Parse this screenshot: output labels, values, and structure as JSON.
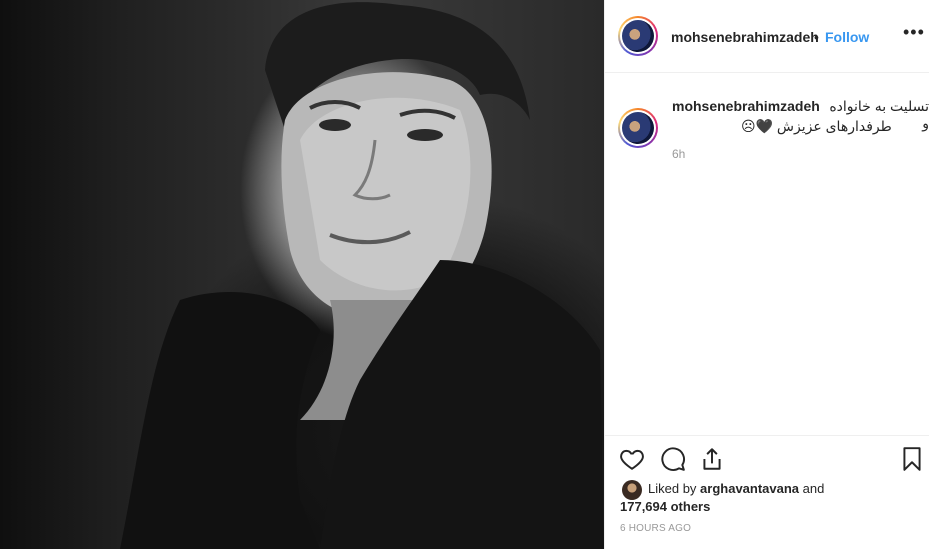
{
  "post": {
    "photo_alt": "black and white portrait of a man",
    "header": {
      "username": "mohsenebrahimzadeh",
      "separator": "•",
      "follow": "Follow",
      "more": "•••"
    },
    "caption": {
      "username": "mohsenebrahimzadeh",
      "line1": "تسلیت به خانواده و",
      "line2": "طرفدارهای عزیزش 🖤☹",
      "time": "6h"
    },
    "actions": {
      "like_icon": "heart-icon",
      "comment_icon": "comment-icon",
      "share_icon": "share-icon",
      "save_icon": "bookmark-icon"
    },
    "likes": {
      "prefix": "Liked by ",
      "user": "arghavantavana",
      "and": " and",
      "count": "177,694 others"
    },
    "timestamp": "6 HOURS AGO"
  }
}
